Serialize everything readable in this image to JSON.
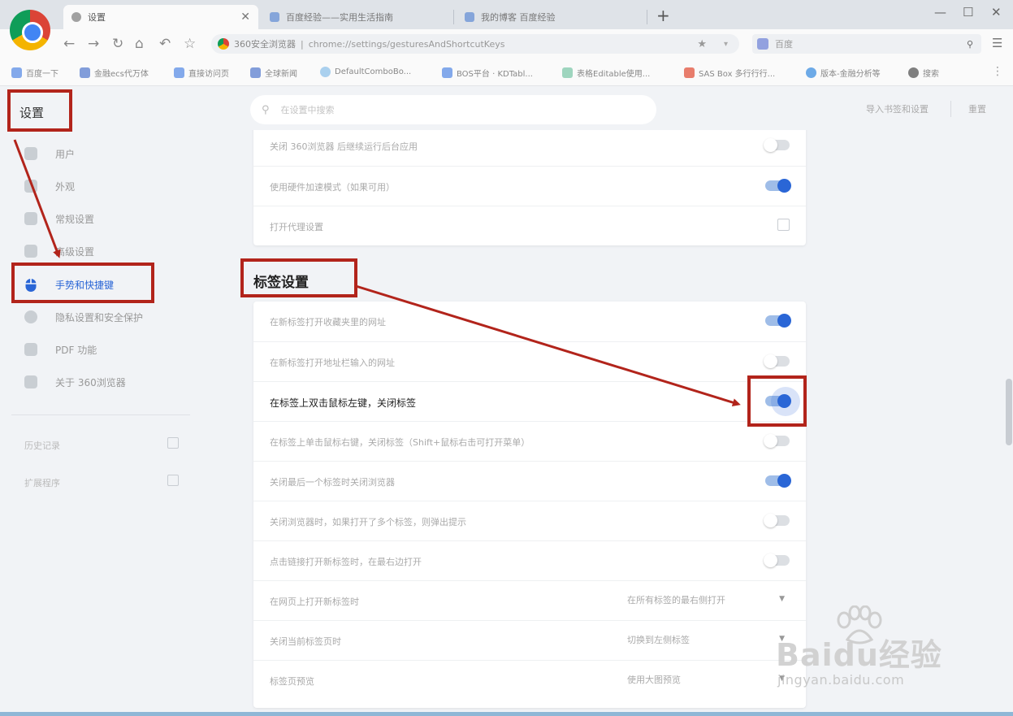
{
  "browser": {
    "tabs": [
      {
        "title": "设置",
        "active": true
      },
      {
        "title": "百度经验——实用生活指南",
        "active": false
      },
      {
        "title": "我的博客 百度经验",
        "active": false
      }
    ],
    "close_glyph": "✕",
    "new_tab_glyph": "+",
    "window_controls": [
      "—",
      "☐",
      "✕"
    ],
    "nav_glyphs": {
      "back": "←",
      "forward": "→",
      "reload": "↻",
      "home": "⌂",
      "undo": "↶",
      "favorite": "☆"
    },
    "address": {
      "site": "360安全浏览器",
      "separator": "|",
      "url": "chrome://settings/gesturesAndShortcutKeys"
    },
    "search_engine_placeholder": "百度",
    "bookmarks": [
      "百度一下",
      "金融ecs代万体",
      "直接访问页",
      "全球新闻",
      "DefaultComboBo...",
      "BOS平台 · KDTabl...",
      "表格Editable使用...",
      "SAS Box 多行行行...",
      "版本-金融分析等",
      "搜索"
    ],
    "bookmark_colors": [
      "#5b8de6",
      "#5a7ecf",
      "#5b8de6",
      "#5a7ecf",
      "#8fc2ea",
      "#5b8de6",
      "#7fc8a9",
      "#e2533c",
      "#3d8fe0",
      "#555555"
    ]
  },
  "sidebar": {
    "title": "设置",
    "items": [
      {
        "label": "用户",
        "icon": "user-icon"
      },
      {
        "label": "外观",
        "icon": "palette-icon"
      },
      {
        "label": "常规设置",
        "icon": "wrench-icon"
      },
      {
        "label": "高级设置",
        "icon": "monitor-icon"
      },
      {
        "label": "手势和快捷键",
        "icon": "mouse-icon",
        "active": true
      },
      {
        "label": "隐私设置和安全保护",
        "icon": "shield-icon"
      },
      {
        "label": "PDF 功能",
        "icon": "pdf-icon"
      },
      {
        "label": "关于 360浏览器",
        "icon": "info-icon"
      }
    ],
    "links": [
      {
        "label": "历史记录"
      },
      {
        "label": "扩展程序"
      }
    ]
  },
  "header": {
    "search_placeholder": "在设置中搜索",
    "import_button": "导入书签和设置",
    "reset_button": "重置"
  },
  "settings": {
    "prev_card_rows": [
      {
        "label": "关闭 360浏览器 后继续运行后台应用",
        "on": false
      },
      {
        "label": "使用硬件加速模式（如果可用）",
        "on": true
      },
      {
        "label": "打开代理设置",
        "type": "link"
      }
    ],
    "tab_section_title": "标签设置",
    "tab_rows": [
      {
        "label": "在新标签打开收藏夹里的网址",
        "on": true
      },
      {
        "label": "在新标签打开地址栏输入的网址",
        "on": false
      },
      {
        "label": "在标签上双击鼠标左键，关闭标签",
        "on": true,
        "focus": true
      },
      {
        "label": "在标签上单击鼠标右键，关闭标签（Shift+鼠标右击可打开菜单）",
        "on": false
      },
      {
        "label": "关闭最后一个标签时关闭浏览器",
        "on": true
      },
      {
        "label": "关闭浏览器时，如果打开了多个标签，则弹出提示",
        "on": false
      },
      {
        "label": "点击链接打开新标签时，在最右边打开",
        "on": false
      },
      {
        "label": "在网页上打开新标签时",
        "type": "select",
        "value": "在所有标签的最右侧打开"
      },
      {
        "label": "关闭当前标签页时",
        "type": "select",
        "value": "切换到左侧标签"
      },
      {
        "label": "标签页预览",
        "type": "select",
        "value": "使用大图预览"
      }
    ]
  },
  "watermark": {
    "brand": "Baidu经验",
    "domain": "jingyan.baidu.com"
  },
  "colors": {
    "accent": "#2a66d6",
    "callout": "#b2241b"
  }
}
